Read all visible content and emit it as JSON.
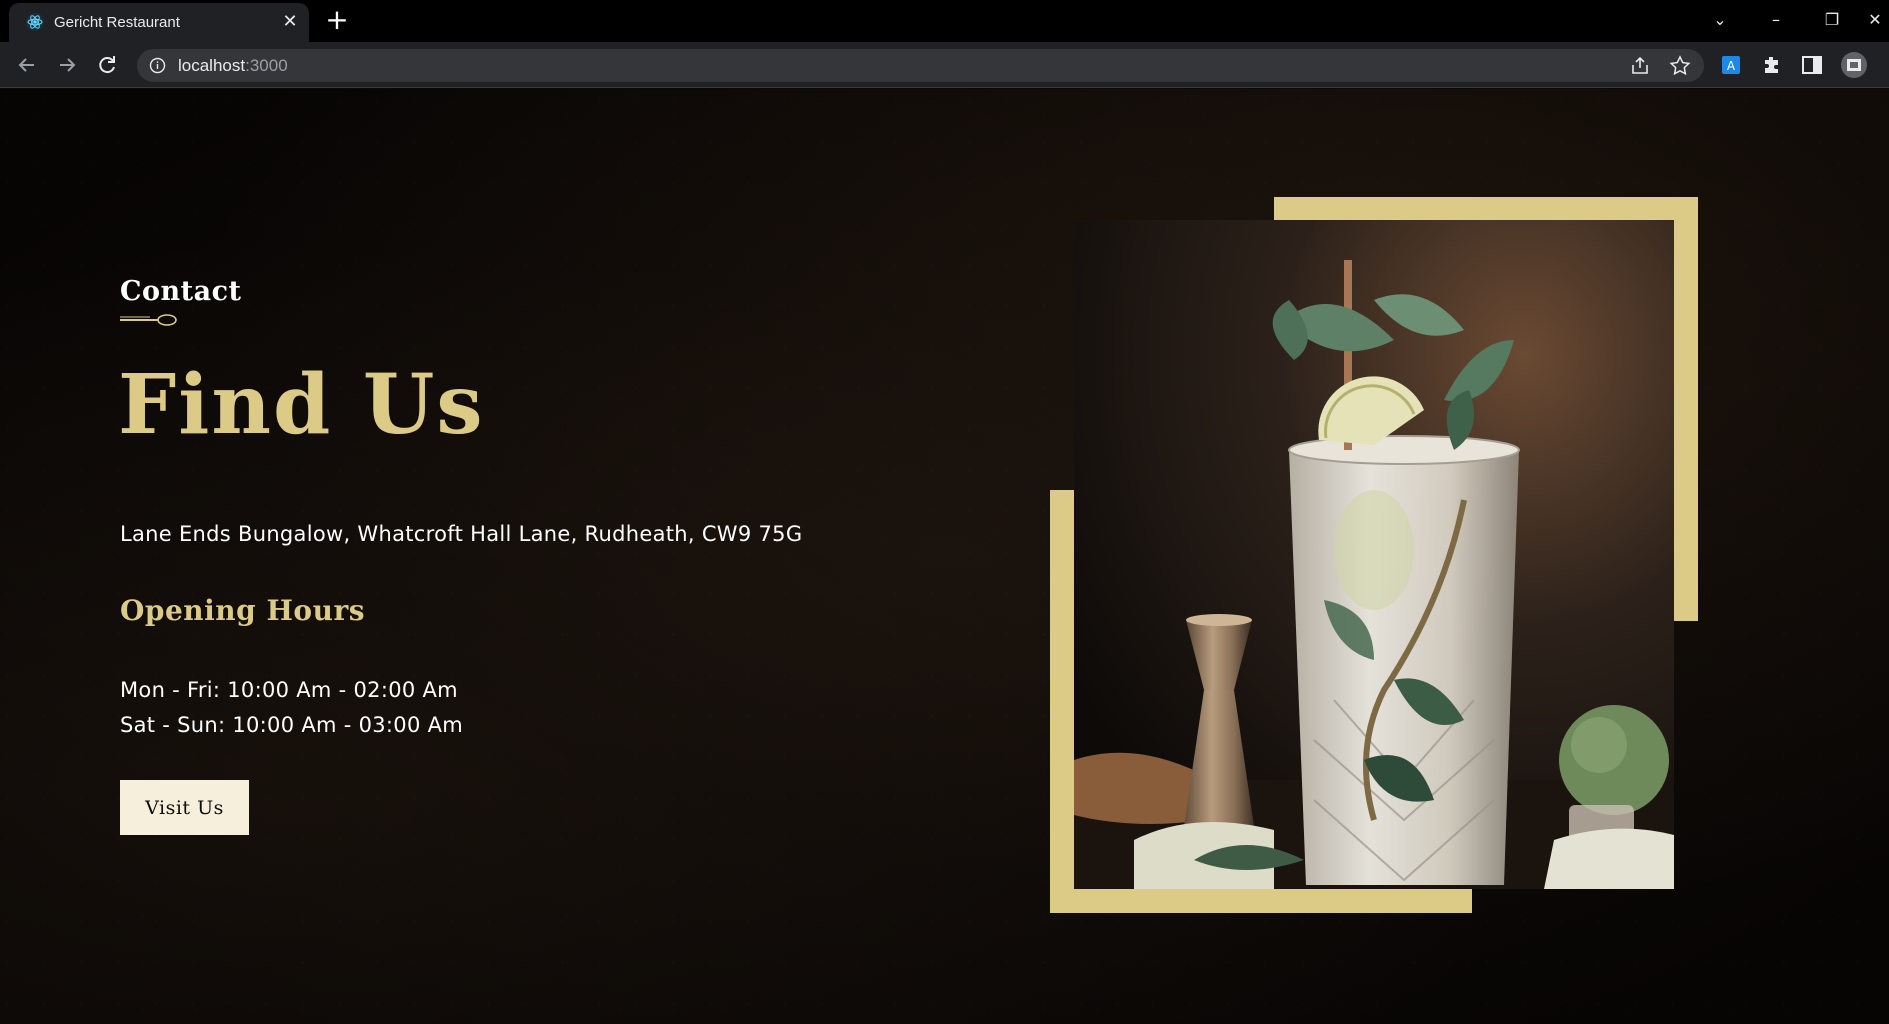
{
  "browser": {
    "tab_title": "Gericht Restaurant",
    "url_host": "localhost",
    "url_port": ":3000"
  },
  "contact": {
    "subtitle": "Contact",
    "headline": "Find Us",
    "address": "Lane Ends Bungalow, Whatcroft Hall Lane, Rudheath, CW9 75G",
    "hours_title": "Opening Hours",
    "hours_weekday": "Mon - Fri: 10:00 Am - 02:00 Am",
    "hours_weekend": "Sat - Sun: 10:00 Am - 03:00 Am",
    "button_label": "Visit Us"
  },
  "colors": {
    "gold": "#dcca87",
    "button_bg": "#f5efdb",
    "background": "#0c0c0c"
  }
}
